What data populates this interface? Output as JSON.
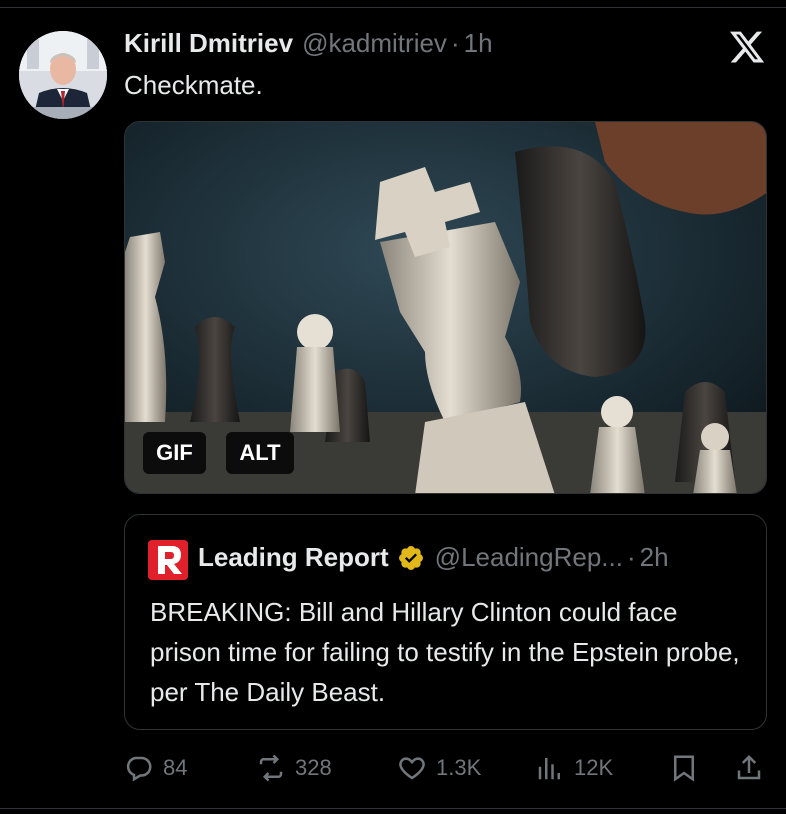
{
  "tweet": {
    "author_name": "Kirill Dmitriev",
    "handle": "@kadmitriev",
    "separator": "·",
    "time": "1h",
    "text": "Checkmate.",
    "media": {
      "gif_label": "GIF",
      "alt_label": "ALT"
    }
  },
  "quoted": {
    "logo_icon": "leading-report-logo",
    "author_name": "Leading Report",
    "handle": "@LeadingRep...",
    "separator": "·",
    "time": "2h",
    "text": "BREAKING: Bill and Hillary Clinton could face prison time for failing to testify in the Epstein probe, per The Daily Beast."
  },
  "actions": {
    "replies": "84",
    "reposts": "328",
    "likes": "1.3K",
    "views": "12K"
  },
  "colors": {
    "background": "#000000",
    "text": "#e7e9ea",
    "muted": "#71767b",
    "border": "#2f3336",
    "verified": "#e2b719",
    "logo_red": "#e0212b"
  }
}
